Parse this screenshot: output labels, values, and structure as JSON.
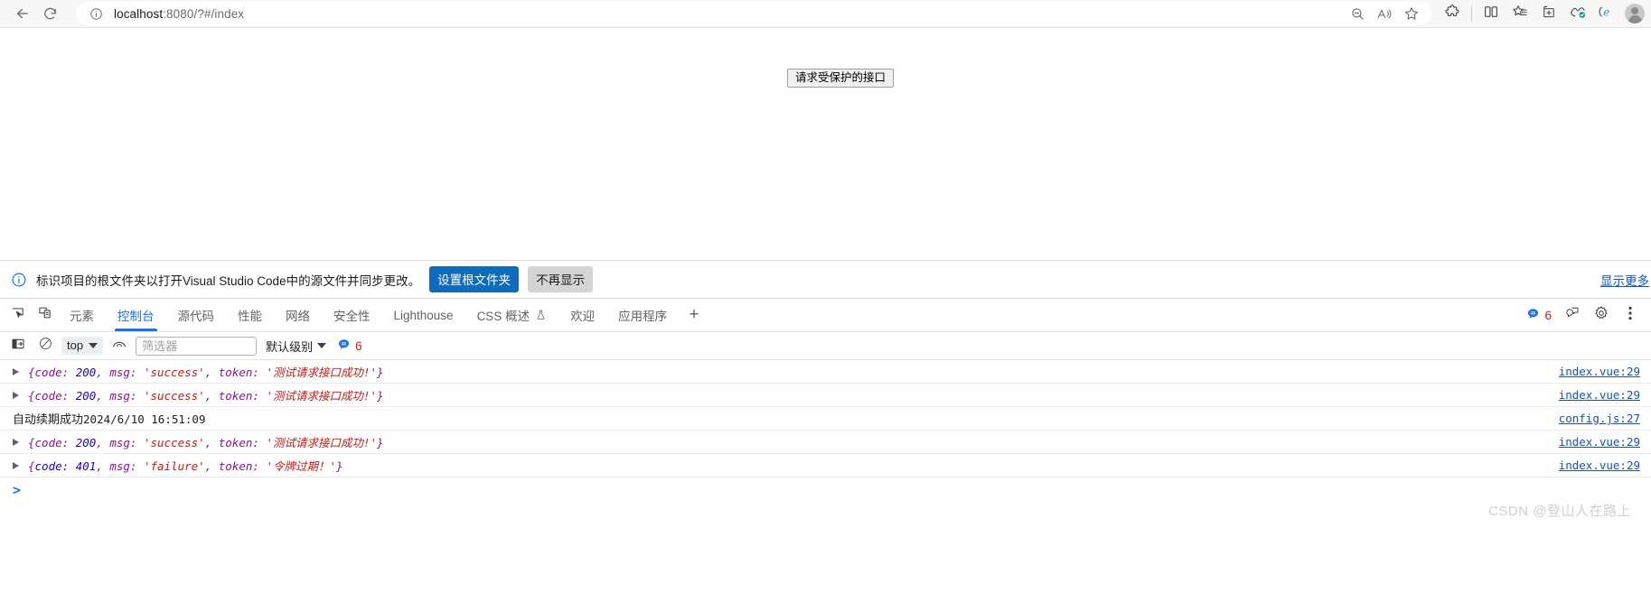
{
  "browser": {
    "back_icon": "back-arrow-icon",
    "reload_icon": "reload-icon",
    "site_info_icon": "info-circle-icon",
    "url_host": "localhost",
    "url_path": ":8080/?#/index",
    "omnibox_icons": [
      "zoom-out-icon",
      "read-aloud-icon",
      "favorite-star-icon"
    ],
    "toolbar_icons": [
      "extensions-icon",
      "split-screen-icon",
      "collections-icon",
      "add-to-tabs-icon",
      "browser-essentials-icon",
      "ie-mode-icon"
    ],
    "profile_icon": "profile-avatar-icon"
  },
  "page": {
    "button_label": "请求受保护的接口"
  },
  "infobar": {
    "icon": "info-circle-icon",
    "message": "标识项目的根文件夹以打开Visual Studio Code中的源文件并同步更改。",
    "primary_button": "设置根文件夹",
    "secondary_button": "不再显示",
    "more_link": "显示更多"
  },
  "devtools": {
    "left_icons": [
      "inspect-element-icon",
      "device-toolbar-icon"
    ],
    "tabs": [
      {
        "label": "元素",
        "active": false,
        "flask": false
      },
      {
        "label": "控制台",
        "active": true,
        "flask": false
      },
      {
        "label": "源代码",
        "active": false,
        "flask": false
      },
      {
        "label": "性能",
        "active": false,
        "flask": false
      },
      {
        "label": "网络",
        "active": false,
        "flask": false
      },
      {
        "label": "安全性",
        "active": false,
        "flask": false
      },
      {
        "label": "Lighthouse",
        "active": false,
        "flask": false
      },
      {
        "label": "CSS 概述",
        "active": false,
        "flask": true
      },
      {
        "label": "欢迎",
        "active": false,
        "flask": false
      },
      {
        "label": "应用程序",
        "active": false,
        "flask": false
      }
    ],
    "add_tab_label": "+",
    "issue_count": "6",
    "right_icons": [
      "feedback-icon",
      "settings-gear-icon",
      "more-options-icon"
    ],
    "console_toolbar": {
      "sidebar_toggle_icon": "console-sidebar-icon",
      "clear_icon": "clear-console-icon",
      "context_value": "top",
      "live_expression_icon": "eye-icon",
      "filter_placeholder": "筛选器",
      "filter_value": "",
      "level_value": "默认级别",
      "issue_count": "6"
    },
    "logs": [
      {
        "type": "object",
        "expandable": true,
        "parts": [
          {
            "t": "{",
            "c": "obj"
          },
          {
            "t": "code: ",
            "c": "obj"
          },
          {
            "t": "200",
            "c": "num"
          },
          {
            "t": ", ",
            "c": "obj"
          },
          {
            "t": "msg: ",
            "c": "obj"
          },
          {
            "t": "'success'",
            "c": "str"
          },
          {
            "t": ", ",
            "c": "obj"
          },
          {
            "t": "token: ",
            "c": "obj"
          },
          {
            "t": "'测试请求接口成功!'",
            "c": "str"
          },
          {
            "t": "}",
            "c": "obj"
          }
        ],
        "source": "index.vue:29"
      },
      {
        "type": "object",
        "expandable": true,
        "parts": [
          {
            "t": "{",
            "c": "obj"
          },
          {
            "t": "code: ",
            "c": "obj"
          },
          {
            "t": "200",
            "c": "num"
          },
          {
            "t": ", ",
            "c": "obj"
          },
          {
            "t": "msg: ",
            "c": "obj"
          },
          {
            "t": "'success'",
            "c": "str"
          },
          {
            "t": ", ",
            "c": "obj"
          },
          {
            "t": "token: ",
            "c": "obj"
          },
          {
            "t": "'测试请求接口成功!'",
            "c": "str"
          },
          {
            "t": "}",
            "c": "obj"
          }
        ],
        "source": "index.vue:29"
      },
      {
        "type": "text",
        "expandable": false,
        "text_label": "自动续期成功",
        "text_mono": "2024/6/10 16:51:09",
        "source": "config.js:27"
      },
      {
        "type": "object",
        "expandable": true,
        "parts": [
          {
            "t": "{",
            "c": "obj"
          },
          {
            "t": "code: ",
            "c": "obj"
          },
          {
            "t": "200",
            "c": "num"
          },
          {
            "t": ", ",
            "c": "obj"
          },
          {
            "t": "msg: ",
            "c": "obj"
          },
          {
            "t": "'success'",
            "c": "str"
          },
          {
            "t": ", ",
            "c": "obj"
          },
          {
            "t": "token: ",
            "c": "obj"
          },
          {
            "t": "'测试请求接口成功!'",
            "c": "str"
          },
          {
            "t": "}",
            "c": "obj"
          }
        ],
        "source": "index.vue:29"
      },
      {
        "type": "object",
        "expandable": true,
        "parts": [
          {
            "t": "{",
            "c": "obj"
          },
          {
            "t": "code: ",
            "c": "num"
          },
          {
            "t": "401",
            "c": "num"
          },
          {
            "t": ", ",
            "c": "obj"
          },
          {
            "t": "msg: ",
            "c": "obj"
          },
          {
            "t": "'failure'",
            "c": "str"
          },
          {
            "t": ", ",
            "c": "obj"
          },
          {
            "t": "token: ",
            "c": "obj"
          },
          {
            "t": "'令牌过期！'",
            "c": "str"
          },
          {
            "t": "}",
            "c": "obj"
          }
        ],
        "source": "index.vue:29"
      }
    ],
    "prompt_caret": ">"
  },
  "watermark": "CSDN @登山人在路上",
  "colors": {
    "accent_blue": "#1a73e8",
    "link_blue": "#1a4fba",
    "primary_button": "#0f6cbd",
    "string_red": "#c41a16",
    "key_purple": "#881391",
    "number_blue": "#1c00cf"
  }
}
